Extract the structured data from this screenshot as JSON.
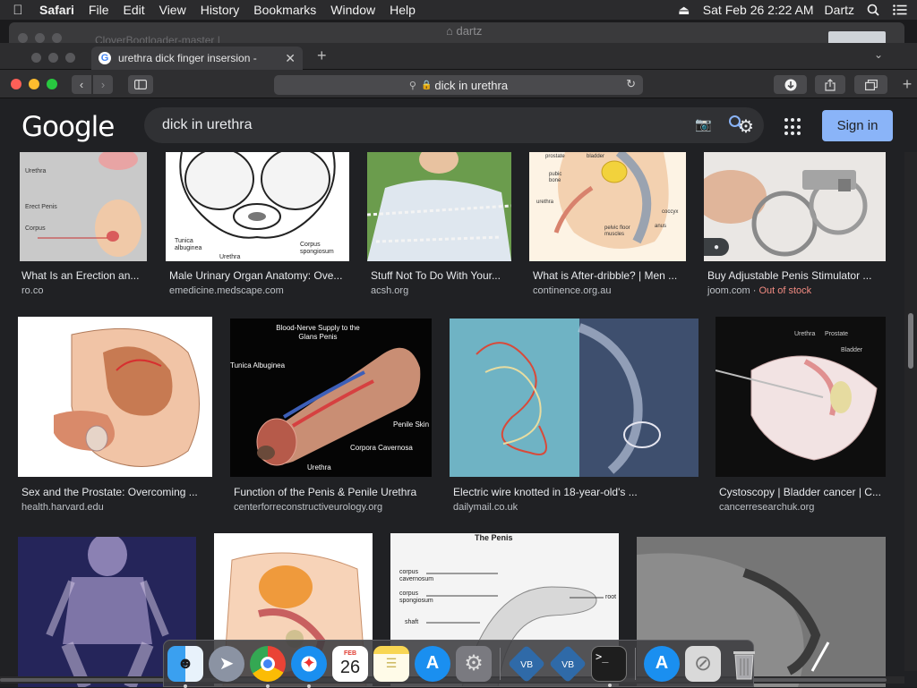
{
  "menubar": {
    "app": "Safari",
    "items": [
      "File",
      "Edit",
      "View",
      "History",
      "Bookmarks",
      "Window",
      "Help"
    ],
    "datetime": "Sat Feb 26  2:22 AM",
    "user": "Dartz"
  },
  "background_window": {
    "title": "dartz",
    "tab_title": "CloverBootloader-master |"
  },
  "safari": {
    "tab_title": "urethra dick finger insersion -",
    "url": "dick in urethra"
  },
  "google": {
    "logo": "Google",
    "query": "dick in urethra",
    "signin_label": "Sign in"
  },
  "results": [
    {
      "title": "What Is an Erection an...",
      "site": "ro.co",
      "note": ""
    },
    {
      "title": "Male Urinary Organ Anatomy: Ove...",
      "site": "emedicine.medscape.com",
      "note": ""
    },
    {
      "title": "Stuff Not To Do With Your...",
      "site": "acsh.org",
      "note": ""
    },
    {
      "title": "What is After-dribble? | Men ...",
      "site": "continence.org.au",
      "note": ""
    },
    {
      "title": "Buy Adjustable Penis Stimulator ...",
      "site": "joom.com",
      "note": "Out of stock"
    },
    {
      "title": "Sex and the Prostate: Overcoming ...",
      "site": "health.harvard.edu",
      "note": ""
    },
    {
      "title": "Function of the Penis & Penile Urethra",
      "site": "centerforreconstructiveurology.org",
      "note": ""
    },
    {
      "title": "Electric wire knotted in 18-year-old's ...",
      "site": "dailymail.co.uk",
      "note": ""
    },
    {
      "title": "Cystoscopy | Bladder cancer | C...",
      "site": "cancerresearchuk.org",
      "note": ""
    }
  ],
  "image_labels": {
    "r1c1": [
      "Erect Penis",
      "Urethra",
      "Corpus"
    ],
    "r1c2": [
      "Tunica albuginea",
      "Urethra",
      "Corpus spongiosum"
    ],
    "r1c4": [
      "prostate",
      "bladder",
      "pubic bone",
      "urethra",
      "pelvic floor muscles",
      "anus",
      "coccyx"
    ],
    "r2c2": [
      "Blood-Nerve Supply to the Glans Penis",
      "Tunica Albuginea",
      "Penile Skin",
      "Corpora Cavernosa",
      "Urethra"
    ],
    "r2c4": [
      "Urethra",
      "Prostate",
      "Bladder"
    ],
    "r3c3": [
      "The Penis",
      "corpus cavernosum",
      "corpus spongiosum",
      "shaft",
      "root"
    ]
  },
  "dock": {
    "calendar_month": "FEB",
    "calendar_day": "26",
    "items": [
      "Finder",
      "Launchpad",
      "Chrome",
      "Safari",
      "Calendar",
      "Notes",
      "App Store",
      "System Preferences",
      "VirtualBox",
      "VirtualBox",
      "Terminal",
      "App Store",
      "Installer",
      "Trash"
    ]
  }
}
